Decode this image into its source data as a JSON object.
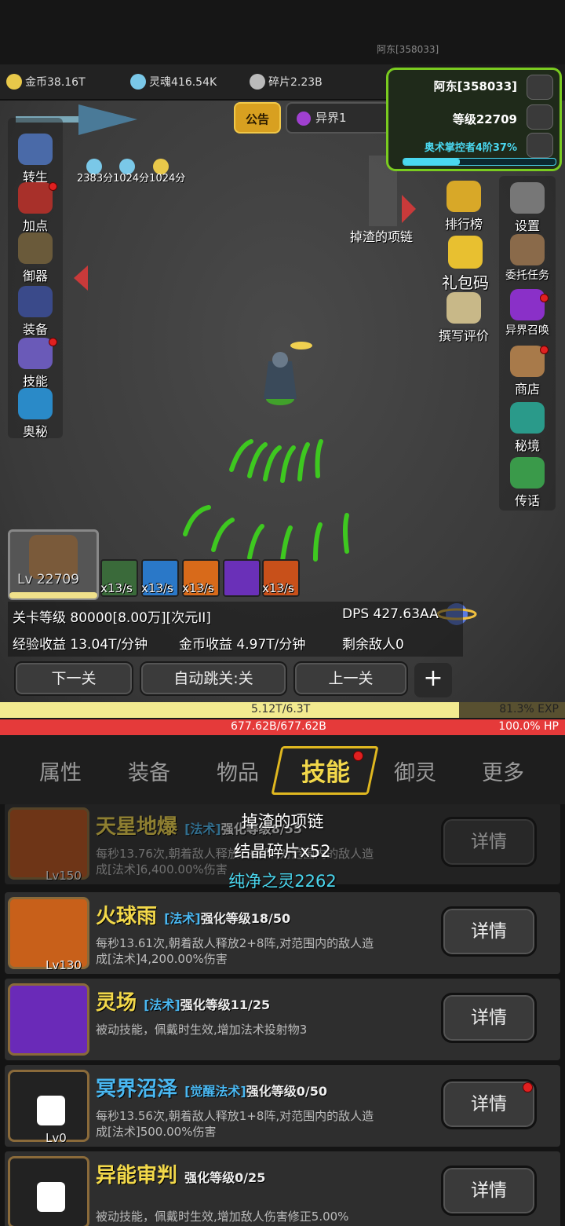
{
  "player_tag": "阿东[358033]",
  "resources": [
    {
      "label": "金币38.16T",
      "color": "#e8c84a"
    },
    {
      "label": "灵魂416.54K",
      "color": "#7ac8e8"
    },
    {
      "label": "碎片2.23B",
      "color": "#bbbbbb"
    }
  ],
  "profile": {
    "name": "阿东[358033]",
    "level": "等级22709",
    "rank": "奥术掌控者4阶37%",
    "rank_progress": 0.37
  },
  "announce_label": "公告",
  "realm_label": "异界1",
  "buffs_text": "2383分1024分1024分",
  "loot_label": "掉渣的项链",
  "left_menu": [
    "转生",
    "加点",
    "御器",
    "装备",
    "技能",
    "奥秘"
  ],
  "right_menu": [
    "排行榜",
    "礼包码",
    "撰写评价"
  ],
  "right_menu2": [
    "设置",
    "委托任务",
    "异界召唤",
    "商店",
    "秘境",
    "传话"
  ],
  "hero": {
    "level": "Lv 22709"
  },
  "skill_rates": [
    "x13/s",
    "x13/s",
    "x13/s",
    "x13/s"
  ],
  "stats": {
    "stage": "关卡等级 80000[8.00万][次元II]",
    "dps": "DPS 427.63AA",
    "exp_income": "经验收益 13.04T/分钟",
    "gold_income": "金币收益 4.97T/分钟",
    "enemies": "剩余敌人0"
  },
  "nav": {
    "next": "下一关",
    "auto": "自动跳关:关",
    "prev": "上一关",
    "plus": "+"
  },
  "exp": {
    "text": "5.12T/6.3T",
    "pct": "81.3% EXP",
    "fill": 0.813
  },
  "hp": {
    "text": "677.62B/677.62B",
    "pct": "100.0%  HP"
  },
  "tabs": [
    "属性",
    "装备",
    "物品",
    "技能",
    "御灵",
    "更多"
  ],
  "popup": {
    "line1": "掉渣的项链",
    "line2": "结晶碎片x52",
    "line3": "纯净之灵2262"
  },
  "skills": [
    {
      "name": "天星地爆",
      "tag": "[法术]",
      "enh": "强化等级8/55",
      "d1": "每秒13.76次,朝着敌人释放1+8阵,对范围内的敌人造",
      "d2": "成[法术]6,400.00%伤害",
      "lv": "Lv150"
    },
    {
      "name": "火球雨",
      "tag": "[法术]",
      "enh": "强化等级18/50",
      "d1": "每秒13.61次,朝着敌人释放2+8阵,对范围内的敌人造",
      "d2": "成[法术]4,200.00%伤害",
      "lv": "Lv130"
    },
    {
      "name": "灵场",
      "tag": "[法术]",
      "enh": "强化等级11/25",
      "d1": "被动技能，佩戴时生效,增加法术投射物3",
      "d2": "",
      "lv": ""
    },
    {
      "name": "冥界沼泽",
      "tag": "[觉醒法术]",
      "enh": "强化等级0/50",
      "d1": "每秒13.56次,朝着敌人释放1+8阵,对范围内的敌人造",
      "d2": "成[法术]500.00%伤害",
      "lv": "Lv0"
    },
    {
      "name": "异能审判",
      "tag": "",
      "enh": "强化等级0/25",
      "d1": "被动技能，佩戴时生效,增加敌人伤害修正5.00%",
      "d2": "",
      "lv": ""
    }
  ],
  "detail_label": "详情"
}
